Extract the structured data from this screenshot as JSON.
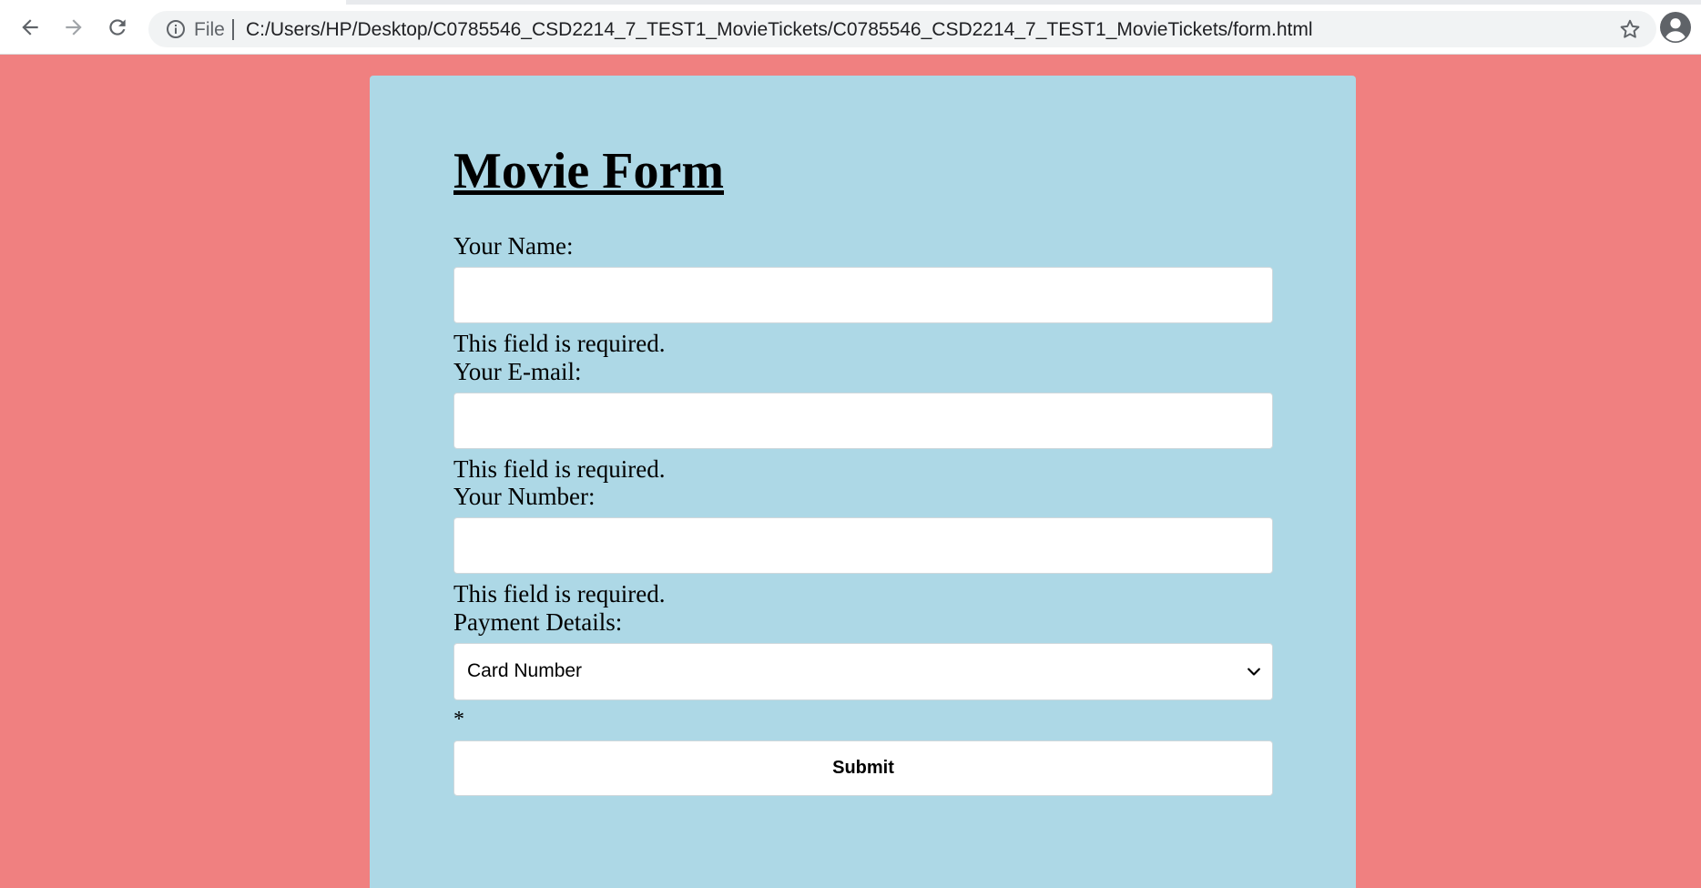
{
  "browser": {
    "file_label": "File",
    "url": "C:/Users/HP/Desktop/C0785546_CSD2214_7_TEST1_MovieTickets/C0785546_CSD2214_7_TEST1_MovieTickets/form.html"
  },
  "form": {
    "title": "Movie Form",
    "name_label": "Your Name:",
    "name_error": "This field is required.",
    "email_label": "Your E-mail:",
    "email_error": "This field is required.",
    "number_label": "Your Number:",
    "number_error": "This field is required.",
    "payment_label": "Payment Details:",
    "payment_selected": "Card Number",
    "asterisk": "*",
    "submit_label": "Submit"
  },
  "colors": {
    "page_background": "#f08080",
    "card_background": "#add8e6"
  }
}
